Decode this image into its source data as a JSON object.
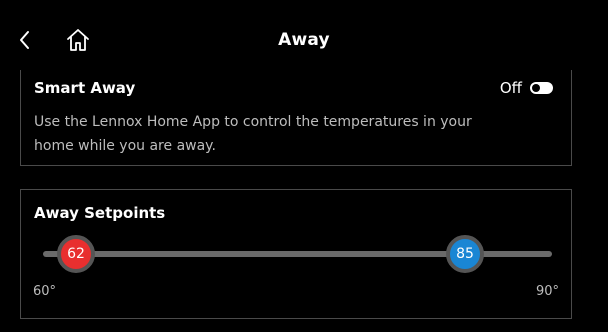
{
  "header": {
    "title": "Away",
    "back_icon": "chevron-left-icon",
    "home_icon": "home-icon"
  },
  "smart_away": {
    "title": "Smart Away",
    "toggle_state_label": "Off",
    "toggle_on": false,
    "description": "Use the Lennox Home App to control the temperatures in your home while you are away."
  },
  "setpoints": {
    "title": "Away Setpoints",
    "heat_value": "62",
    "cool_value": "85",
    "range_min_label": "60°",
    "range_max_label": "90°",
    "heat_color": "#e82f2f",
    "cool_color": "#1a86d4"
  }
}
